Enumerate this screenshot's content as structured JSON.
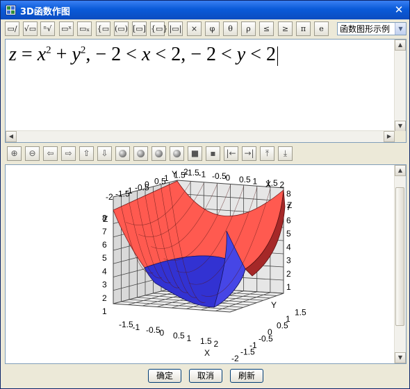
{
  "window": {
    "title": "3D函数作图",
    "close_glyph": "✕"
  },
  "toolbar": {
    "buttons": [
      {
        "name": "fraction-template-button",
        "glyph": "▭/▭"
      },
      {
        "name": "sqrt-template-button",
        "glyph": "√▭"
      },
      {
        "name": "nth-root-template-button",
        "glyph": "ⁿ√"
      },
      {
        "name": "superscript-template-button",
        "glyph": "▭ˣ"
      },
      {
        "name": "subscript-template-button",
        "glyph": "▭ₓ"
      },
      {
        "name": "brace-template-button",
        "glyph": "{▭"
      },
      {
        "name": "parentheses-template-button",
        "glyph": "(▭)"
      },
      {
        "name": "brackets-template-button",
        "glyph": "[▭]"
      },
      {
        "name": "braces-template-button",
        "glyph": "{▭}"
      },
      {
        "name": "abs-template-button",
        "glyph": "|▭|"
      },
      {
        "name": "times-button",
        "glyph": "×"
      },
      {
        "name": "phi-button",
        "glyph": "φ"
      },
      {
        "name": "theta-button",
        "glyph": "θ"
      },
      {
        "name": "rho-button",
        "glyph": "ρ"
      },
      {
        "name": "leq-button",
        "glyph": "≤"
      },
      {
        "name": "geq-button",
        "glyph": "≥"
      },
      {
        "name": "pi-button",
        "glyph": "π"
      },
      {
        "name": "e-button",
        "glyph": "e"
      }
    ],
    "example_select": {
      "value": "函数图形示例"
    }
  },
  "editor": {
    "formula": {
      "z": "z",
      "eq": " = ",
      "x": "x",
      "sq1": "2",
      "plus": " + ",
      "y": "y",
      "sq2": "2",
      "rest1": ",  − 2 < ",
      "x2": "x",
      "rest2": " < 2,  − 2 < ",
      "y2": "y",
      "rest3": " < 2"
    }
  },
  "view_toolbar": {
    "buttons": [
      {
        "name": "zoom-in-button",
        "glyph": "⊕"
      },
      {
        "name": "zoom-out-button",
        "glyph": "⊖"
      },
      {
        "name": "rotate-left-button",
        "glyph": "⇦"
      },
      {
        "name": "rotate-right-button",
        "glyph": "⇨"
      },
      {
        "name": "rotate-up-button",
        "glyph": "⇧"
      },
      {
        "name": "rotate-down-button",
        "glyph": "⇩"
      },
      {
        "name": "shading-1-button",
        "glyph": ""
      },
      {
        "name": "shading-2-button",
        "glyph": ""
      },
      {
        "name": "shading-3-button",
        "glyph": ""
      },
      {
        "name": "shading-4-button",
        "glyph": ""
      },
      {
        "name": "box-on-button",
        "glyph": "■"
      },
      {
        "name": "box-off-button",
        "glyph": "▪"
      },
      {
        "name": "move-left-button",
        "glyph": "|←"
      },
      {
        "name": "move-right-button",
        "glyph": "→|"
      },
      {
        "name": "move-up-button",
        "glyph": "⤒"
      },
      {
        "name": "move-down-button",
        "glyph": "⤓"
      }
    ]
  },
  "plot": {
    "axis_labels": {
      "x": "X",
      "y": "Y",
      "z": "Z"
    },
    "ticks": {
      "top_x": [
        "-1.5",
        "-1",
        "-0.5",
        "0",
        "0.5",
        "1",
        "1.5",
        "2"
      ],
      "top_y": [
        "-2",
        "-1.5",
        "-1",
        "-0.5",
        "0",
        "0.5",
        "1",
        "1.5",
        "2"
      ],
      "z_left": [
        "1",
        "2",
        "3",
        "4",
        "5",
        "6",
        "7",
        "8"
      ],
      "z_right": [
        "1",
        "2",
        "3",
        "4",
        "5",
        "6",
        "7",
        "8"
      ],
      "bottom_x": [
        "-1.5",
        "-1",
        "-0.5",
        "0",
        "0.5",
        "1",
        "1.5",
        "2"
      ],
      "bottom_y": [
        "-2",
        "-1.5",
        "-1",
        "-0.5",
        "0",
        "0.5",
        "1",
        "1.5"
      ]
    },
    "colors": {
      "surface_top": "#FF5A50",
      "surface_bottom": "#3232D2",
      "surface_right": "#A52828",
      "grid": "#444444",
      "wall": "#D9D9D9"
    }
  },
  "footer": {
    "ok_label": "确定",
    "cancel_label": "取消",
    "refresh_label": "刷新"
  }
}
